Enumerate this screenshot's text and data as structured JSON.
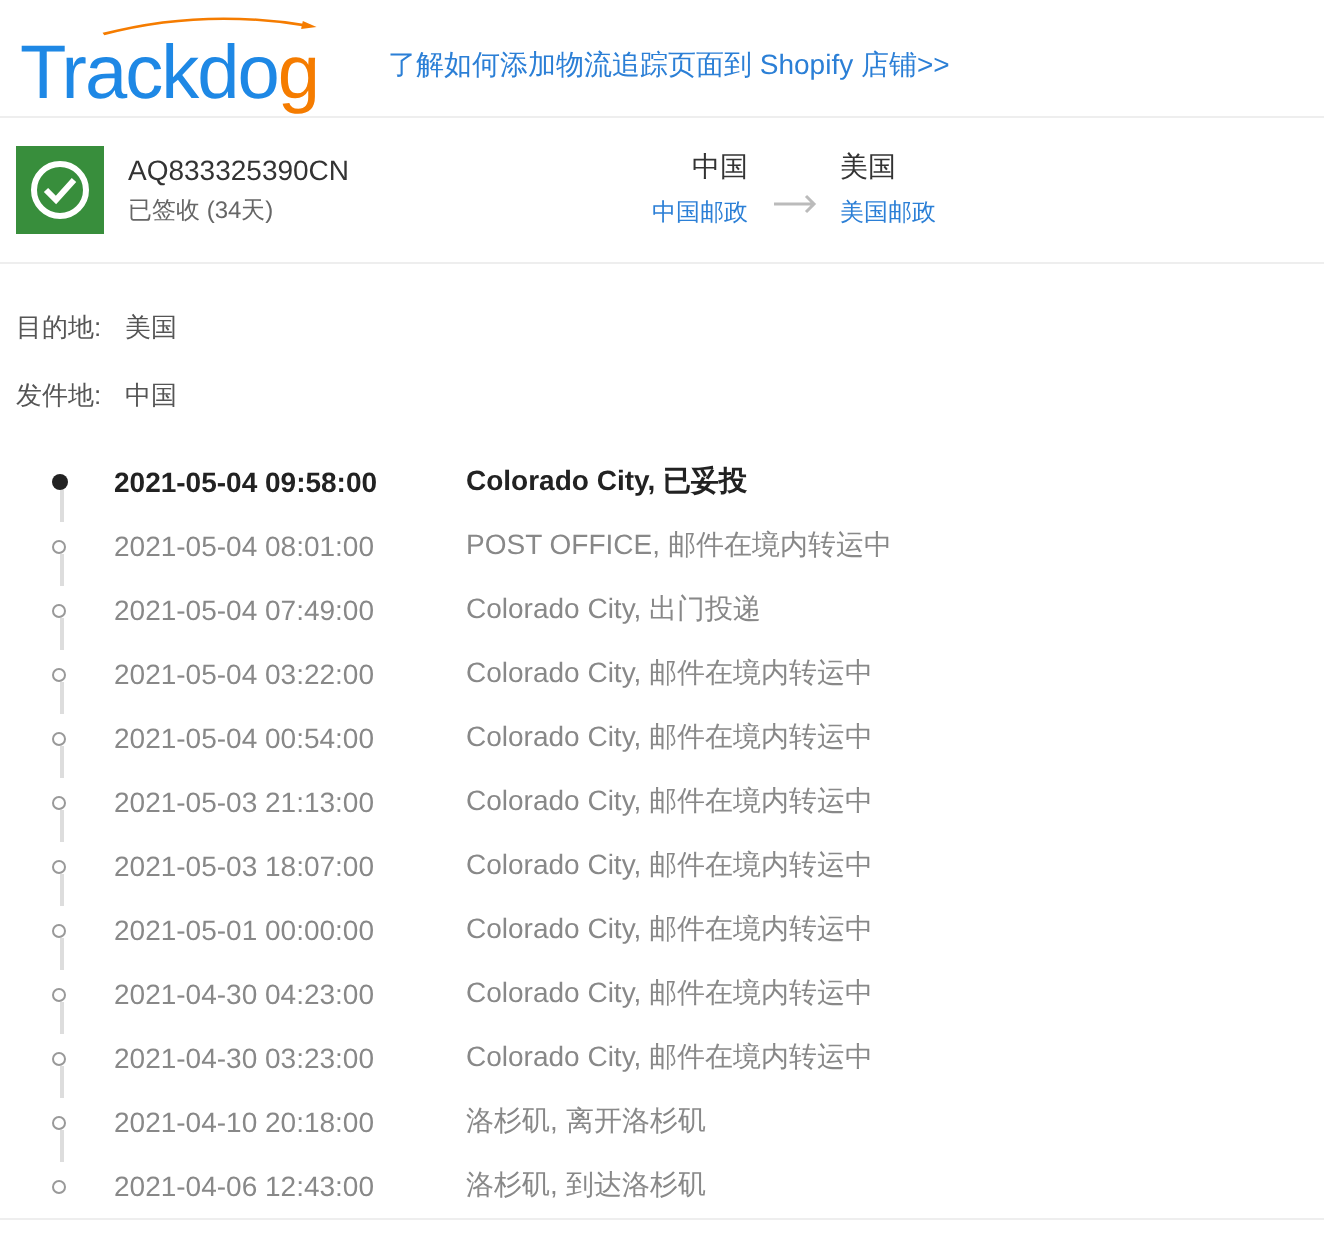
{
  "header": {
    "logo": "Trackdog",
    "link": "了解如何添加物流追踪页面到 Shopify 店铺>>"
  },
  "parcel": {
    "number": "AQ833325390CN",
    "status": "已签收 (34天)",
    "delivered": true,
    "from": {
      "country": "中国",
      "carrier": "中国邮政"
    },
    "to": {
      "country": "美国",
      "carrier": "美国邮政"
    }
  },
  "details": [
    {
      "label": "目的地:",
      "value": "美国"
    },
    {
      "label": "发件地:",
      "value": "中国"
    }
  ],
  "events": [
    {
      "kind": "latest",
      "time": "2021-05-04 09:58:00",
      "description": "Colorado City, 已妥投"
    },
    {
      "kind": "past",
      "time": "2021-05-04 08:01:00",
      "description": "POST OFFICE, 邮件在境内转运中"
    },
    {
      "kind": "past",
      "time": "2021-05-04 07:49:00",
      "description": "Colorado City, 出门投递"
    },
    {
      "kind": "past",
      "time": "2021-05-04 03:22:00",
      "description": "Colorado City, 邮件在境内转运中"
    },
    {
      "kind": "past",
      "time": "2021-05-04 00:54:00",
      "description": "Colorado City, 邮件在境内转运中"
    },
    {
      "kind": "past",
      "time": "2021-05-03 21:13:00",
      "description": "Colorado City, 邮件在境内转运中"
    },
    {
      "kind": "past",
      "time": "2021-05-03 18:07:00",
      "description": "Colorado City, 邮件在境内转运中"
    },
    {
      "kind": "past",
      "time": "2021-05-01 00:00:00",
      "description": "Colorado City, 邮件在境内转运中"
    },
    {
      "kind": "past",
      "time": "2021-04-30 04:23:00",
      "description": "Colorado City, 邮件在境内转运中"
    },
    {
      "kind": "past",
      "time": "2021-04-30 03:23:00",
      "description": "Colorado City, 邮件在境内转运中"
    },
    {
      "kind": "past",
      "time": "2021-04-10 20:18:00",
      "description": "洛杉矶, 离开洛杉矶"
    },
    {
      "kind": "past",
      "time": "2021-04-06 12:43:00",
      "description": "洛杉矶, 到达洛杉矶"
    }
  ]
}
